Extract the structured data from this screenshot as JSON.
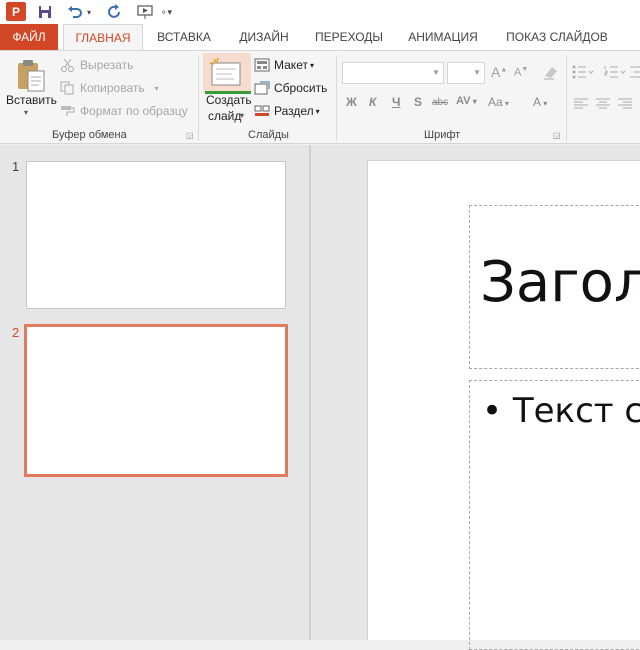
{
  "tabs": {
    "file": "ФАЙЛ",
    "home": "ГЛАВНАЯ",
    "insert": "ВСТАВКА",
    "design": "ДИЗАЙН",
    "transitions": "ПЕРЕХОДЫ",
    "animations": "АНИМАЦИЯ",
    "slideshow": "ПОКАЗ СЛАЙДОВ"
  },
  "clipboard": {
    "paste": "Вставить",
    "cut": "Вырезать",
    "copy": "Копировать",
    "format_painter": "Формат по образцу",
    "group_label": "Буфер обмена"
  },
  "slides_group": {
    "new_slide_line1": "Создать",
    "new_slide_line2": "слайд",
    "layout": "Макет",
    "reset": "Сбросить",
    "section": "Раздел",
    "group_label": "Слайды"
  },
  "font_group": {
    "group_label": "Шрифт",
    "bold": "Ж",
    "italic": "К",
    "underline": "Ч",
    "shadow": "S",
    "strike": "abc",
    "spacing": "AV",
    "case": "Aa",
    "color": "A",
    "grow": "A",
    "shrink": "A"
  },
  "thumbnails": [
    {
      "number": "1",
      "selected": false
    },
    {
      "number": "2",
      "selected": true
    }
  ],
  "slide": {
    "title": "Заголовок слайда",
    "body": "Текст слайда"
  },
  "colors": {
    "accent": "#d24726",
    "selection": "#e07a5f"
  }
}
